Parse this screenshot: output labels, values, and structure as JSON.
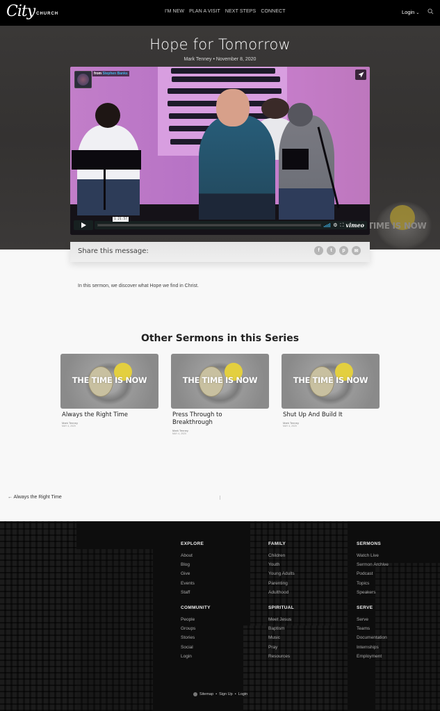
{
  "header": {
    "logo_script": "City",
    "logo_word": "CHURCH",
    "nav": [
      "I'M NEW",
      "PLAN A VISIT",
      "NEXT STEPS",
      "CONNECT"
    ],
    "login_label": "Login",
    "icons": {
      "login_dropdown": "chevron-down-icon",
      "search": "search-icon"
    }
  },
  "hero": {
    "title": "Hope for Tomorrow",
    "meta": "Mark Tenney • November 8, 2020",
    "background_art_text": "TIME IS NOW"
  },
  "video": {
    "from_prefix": "from",
    "from_author": "Stephen Banks",
    "timecode": "1:21:57",
    "brand": "vimeo",
    "icons": {
      "share": "paper-plane-icon",
      "play": "play-icon",
      "volume": "volume-icon",
      "settings": "gear-icon",
      "fullscreen": "fullscreen-icon"
    }
  },
  "share": {
    "label": "Share this message:",
    "networks": [
      {
        "name": "facebook",
        "glyph": "f"
      },
      {
        "name": "twitter",
        "glyph": "t"
      },
      {
        "name": "pinterest",
        "glyph": "p"
      },
      {
        "name": "email",
        "glyph": "✉"
      }
    ]
  },
  "description": "In this sermon, we discover what Hope we find in Christ.",
  "series": {
    "heading": "Other Sermons in this Series",
    "thumbnail_text": "THE TIME IS NOW",
    "sermons": [
      {
        "title": "Always the Right Time",
        "author": "Mark Tenney",
        "date": "May 4, 2020"
      },
      {
        "title": "Press Through to Breakthrough",
        "author": "Mark Tenney",
        "date": "May 4, 2020"
      },
      {
        "title": "Shut Up And Build It",
        "author": "Mark Tenney",
        "date": "May 4, 2020"
      }
    ]
  },
  "pagination": {
    "prev_label": "← Always the Right Time"
  },
  "footer": {
    "columns": [
      {
        "heading": "EXPLORE",
        "links": [
          "About",
          "Blog",
          "Give",
          "Events",
          "Staff"
        ]
      },
      {
        "heading": "FAMILY",
        "links": [
          "Children",
          "Youth",
          "Young Adults",
          "Parenting",
          "Adulthood"
        ]
      },
      {
        "heading": "SERMONS",
        "links": [
          "Watch Live",
          "Sermon Archive",
          "Podcast",
          "Topics",
          "Speakers"
        ]
      },
      {
        "heading": "COMMUNITY",
        "links": [
          "People",
          "Groups",
          "Stories",
          "Social",
          "Login"
        ]
      },
      {
        "heading": "SPIRITUAL",
        "links": [
          "Meet Jesus",
          "Baptism",
          "Music",
          "Pray",
          "Resources"
        ]
      },
      {
        "heading": "SERVE",
        "links": [
          "Serve",
          "Teams",
          "Documentation",
          "Internships",
          "Employment"
        ]
      }
    ],
    "bottom_links": [
      "Sitemap",
      "Sign Up",
      "Login"
    ],
    "bottom_separator": " • "
  }
}
